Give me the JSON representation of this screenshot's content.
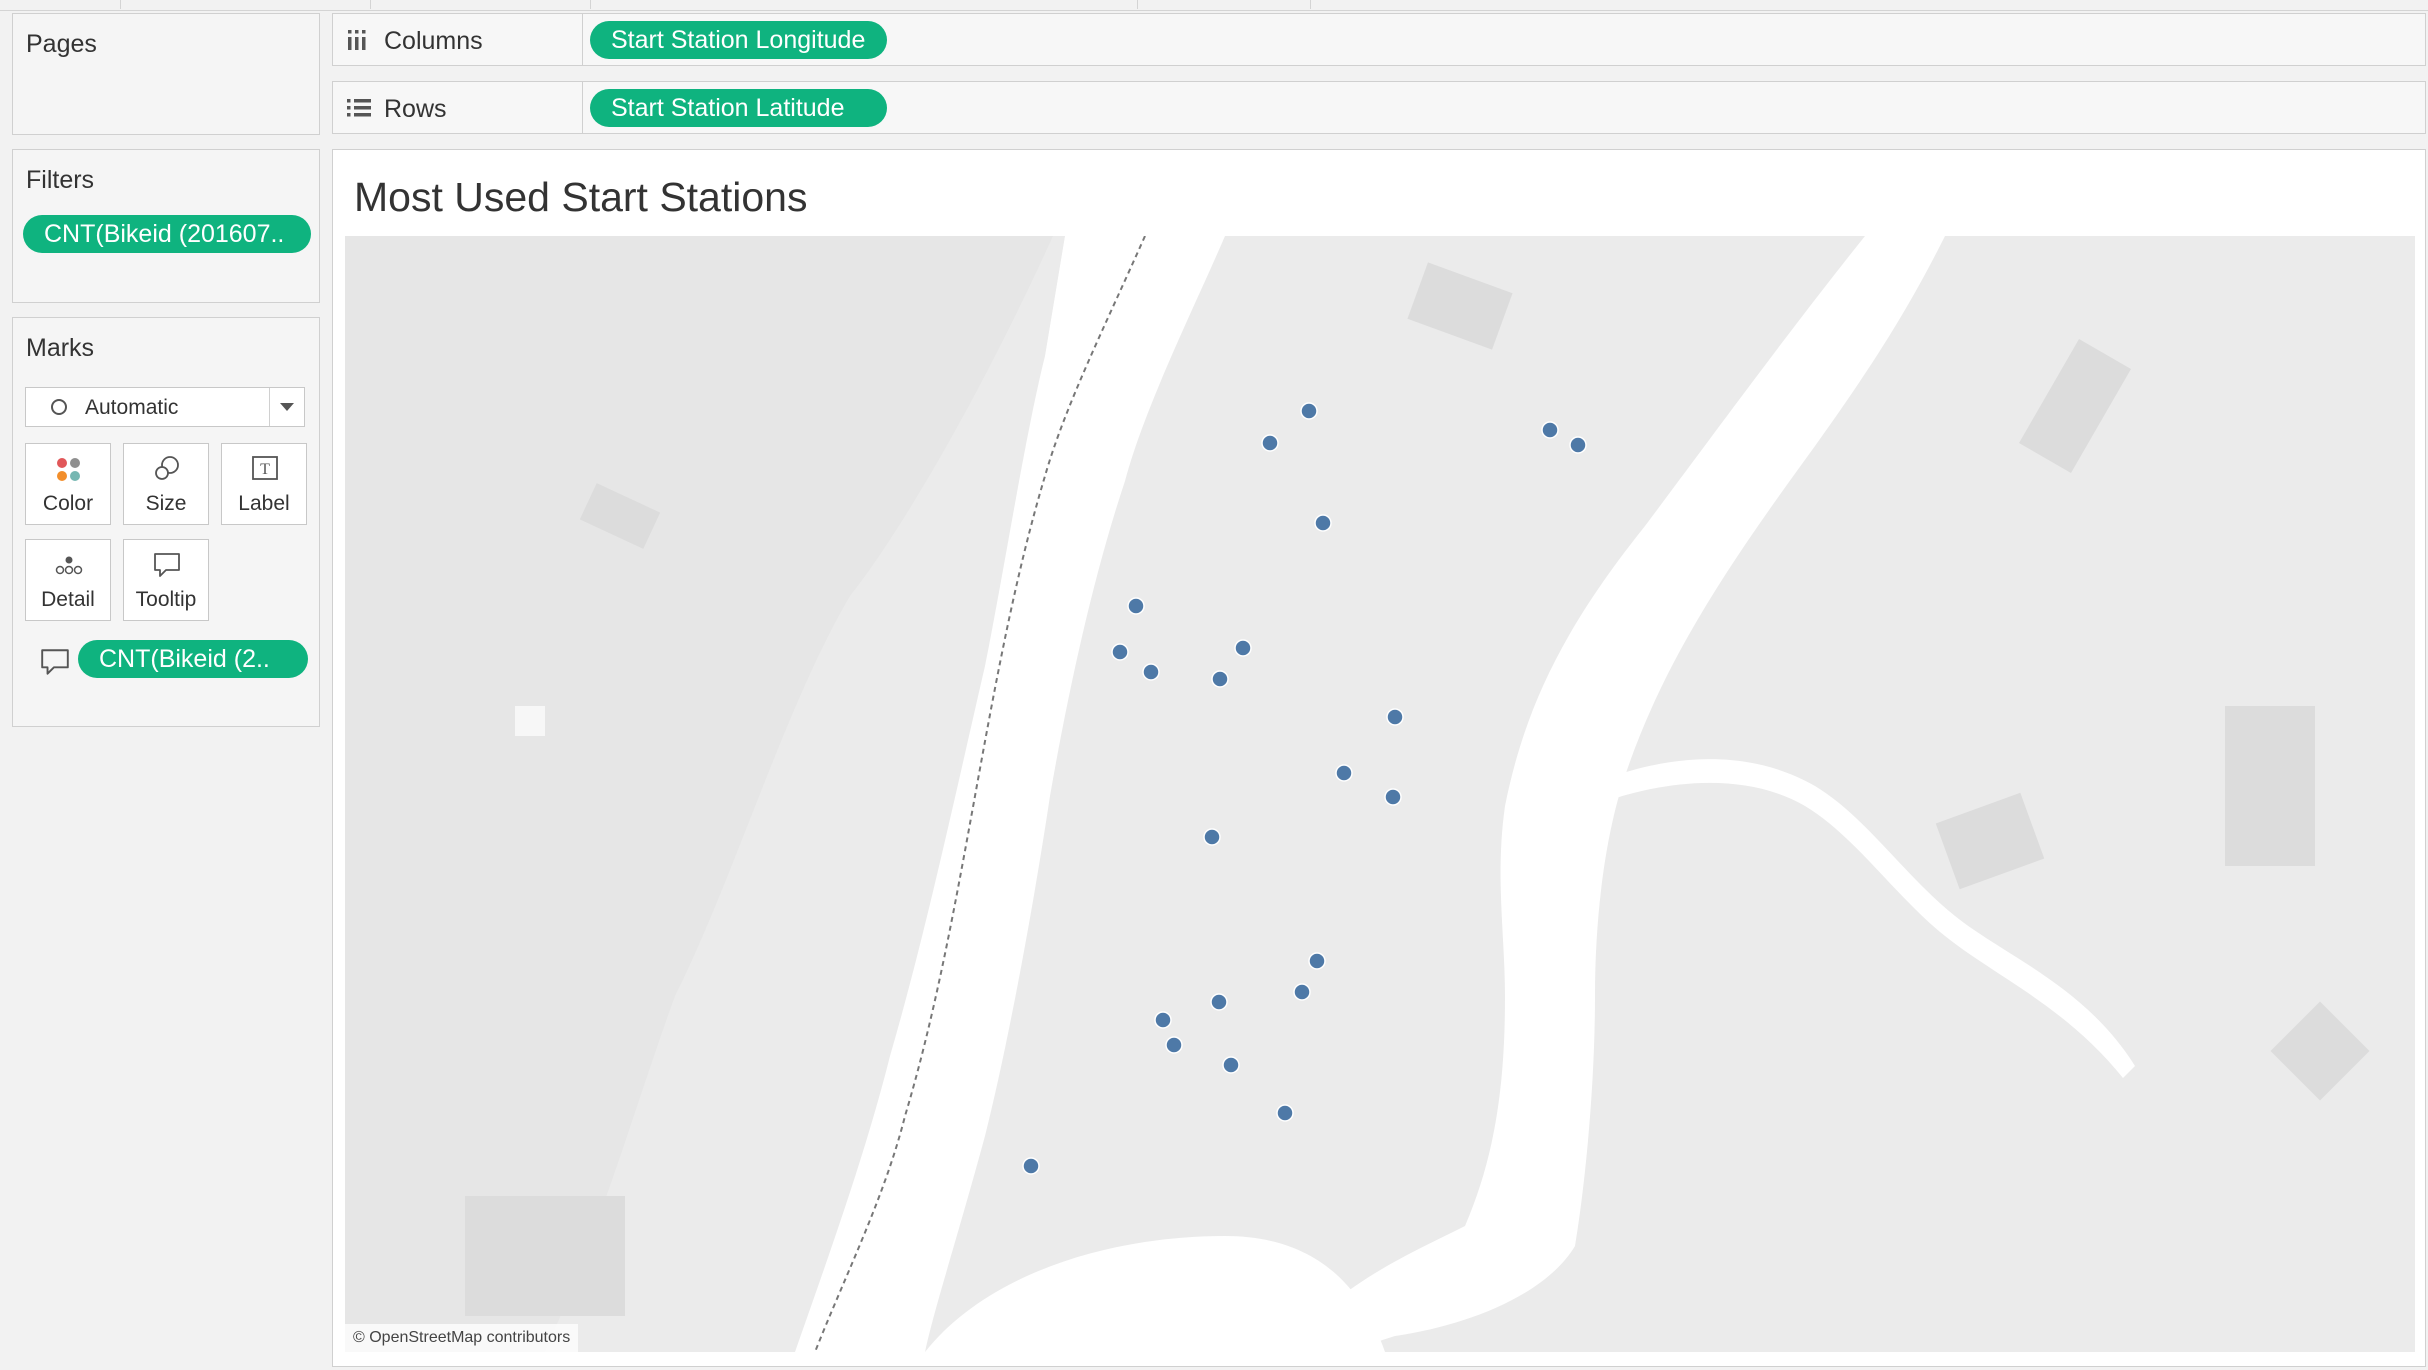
{
  "shelves": {
    "columns": {
      "label": "Columns",
      "pill": "Start Station Longitude"
    },
    "rows": {
      "label": "Rows",
      "pill": "Start Station Latitude"
    }
  },
  "pages": {
    "title": "Pages"
  },
  "filters": {
    "title": "Filters",
    "pill": "CNT(Bikeid (201607.."
  },
  "marks": {
    "title": "Marks",
    "mark_type": "Automatic",
    "buttons": {
      "color": "Color",
      "size": "Size",
      "label": "Label",
      "detail": "Detail",
      "tooltip": "Tooltip"
    },
    "tooltip_pill": "CNT(Bikeid (2.."
  },
  "viz": {
    "title": "Most Used Start Stations",
    "attribution": "© OpenStreetMap contributors",
    "mark_color": "#4e79a7",
    "pill_color": "#0fb37f"
  }
}
